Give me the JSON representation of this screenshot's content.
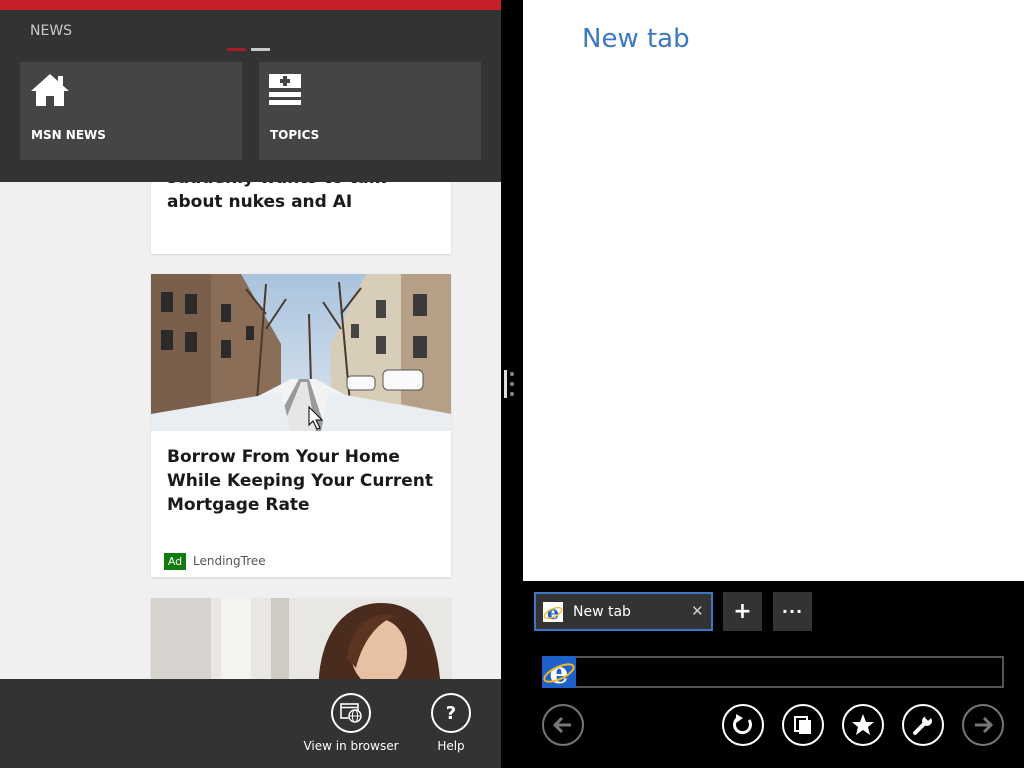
{
  "left_app": {
    "app_name": "NEWS",
    "nav_tiles": [
      {
        "label": "MSN NEWS",
        "icon": "home-icon"
      },
      {
        "label": "TOPICS",
        "icon": "topics-icon"
      }
    ],
    "articles": [
      {
        "title": "suddenly wants to talk about nukes and AI"
      },
      {
        "title": "Borrow From Your Home While Keeping Your Current Mortgage Rate",
        "badge": "Ad",
        "source": "LendingTree",
        "image": "snowy-street-photo"
      },
      {
        "image": "woman-photo"
      }
    ],
    "app_bar": {
      "view_in_browser_label": "View in browser",
      "help_label": "Help",
      "help_symbol": "?"
    }
  },
  "browser": {
    "page_heading": "New tab",
    "tab": {
      "label": "New tab",
      "close_symbol": "✕"
    },
    "new_tab_symbol": "+",
    "more_symbol": "···",
    "address": {
      "value": "",
      "placeholder": ""
    },
    "nav_icons": [
      "back-icon",
      "refresh-icon",
      "tabs-icon",
      "favorites-icon",
      "tools-icon",
      "forward-icon"
    ]
  },
  "colors": {
    "accent_red": "#c8202a",
    "ie_blue": "#3b77c4",
    "ad_green": "#107c10",
    "panel_gray": "#333333"
  }
}
